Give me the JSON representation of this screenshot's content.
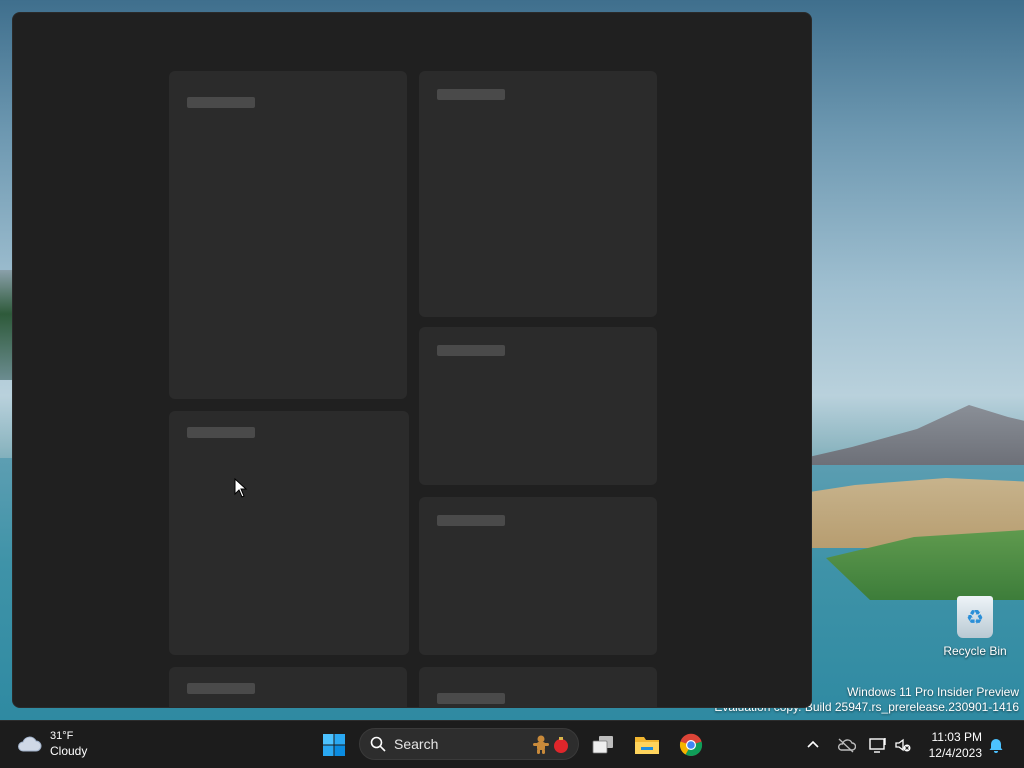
{
  "desktop": {
    "recycle_bin_label": "Recycle Bin",
    "watermark_line1": "Windows 11 Pro Insider Preview",
    "watermark_line2": "Evaluation copy. Build 25947.rs_prerelease.230901-1416"
  },
  "widgets": {
    "state": "loading",
    "background": "#202020",
    "card_color": "#2b2b2b"
  },
  "taskbar": {
    "weather": {
      "temp": "31°F",
      "condition": "Cloudy",
      "icon": "cloud-icon"
    },
    "search": {
      "placeholder": "Search"
    },
    "apps": [
      {
        "name": "Start",
        "icon": "windows-start-icon"
      },
      {
        "name": "Task View",
        "icon": "task-view-icon"
      },
      {
        "name": "File Explorer",
        "icon": "folder-icon"
      },
      {
        "name": "Google Chrome",
        "icon": "chrome-icon"
      }
    ],
    "tray": {
      "icons": [
        "chevron-up-icon",
        "onedrive-icon",
        "network-icon",
        "volume-muted-icon"
      ],
      "time": "11:03 PM",
      "date": "12/4/2023",
      "notification_icon": "bell-icon"
    }
  },
  "colors": {
    "accent": "#0078d4",
    "taskbar_bg": "#1c1c1c"
  }
}
